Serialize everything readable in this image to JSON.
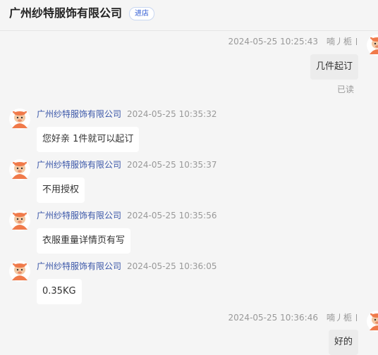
{
  "header": {
    "shop_name": "广州纱特服饰有限公司",
    "enter_shop": "进店"
  },
  "messages": [
    {
      "side": "right",
      "time": "2024-05-25 10:25:43",
      "sender": "喃丿栀",
      "text": "几件起订",
      "status": "已读"
    },
    {
      "side": "left",
      "sender": "广州纱特服饰有限公司",
      "time": "2024-05-25 10:35:32",
      "text": "您好亲 1件就可以起订"
    },
    {
      "side": "left",
      "sender": "广州纱特服饰有限公司",
      "time": "2024-05-25 10:35:37",
      "text": "不用授权"
    },
    {
      "side": "left",
      "sender": "广州纱特服饰有限公司",
      "time": "2024-05-25 10:35:56",
      "text": "衣服重量详情页有写"
    },
    {
      "side": "left",
      "sender": "广州纱特服饰有限公司",
      "time": "2024-05-25 10:36:05",
      "text": "0.35KG"
    },
    {
      "side": "right",
      "time": "2024-05-25 10:36:46",
      "sender": "喃丿栀",
      "text": "好的"
    }
  ],
  "icons": {
    "avatar": "mascot-avatar-icon"
  },
  "colors": {
    "accent": "#2f5bd3",
    "sender_name": "#3a56a8",
    "muted": "#999999",
    "avatar": "#f07a4a"
  }
}
